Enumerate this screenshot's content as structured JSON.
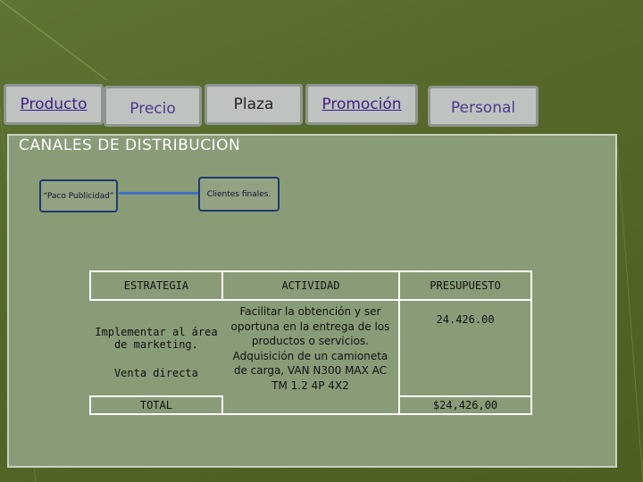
{
  "tabs": [
    {
      "label": "Producto"
    },
    {
      "label": "Precio"
    },
    {
      "label": "Plaza"
    },
    {
      "label": "Promoción"
    },
    {
      "label": "Personal"
    }
  ],
  "section": {
    "title": "CANALES DE DISTRIBUCION"
  },
  "flow": {
    "source": "“Paco Publicidad”",
    "target": "Clientes finales."
  },
  "table": {
    "headers": [
      "ESTRATEGIA",
      "ACTIVIDAD",
      "PRESUPUESTO"
    ],
    "strategy_1": "Implementar al área de marketing.",
    "strategy_2": "Venta directa",
    "activity": "Facilitar la obtención y ser oportuna en la entrega de los productos o servicios. Adquisición de un camioneta de carga, VAN N300 MAX AC TM 1.2 4P 4X2",
    "budget": "24.426.00",
    "total_label": "TOTAL",
    "total_value": "$24,426,00"
  },
  "colors": {
    "background": "#4a5a12",
    "content_panel": "#899c77",
    "tab_fill": "#bfc3c0",
    "node_border": "#1f3a6b",
    "arrow": "#3f72c4"
  }
}
